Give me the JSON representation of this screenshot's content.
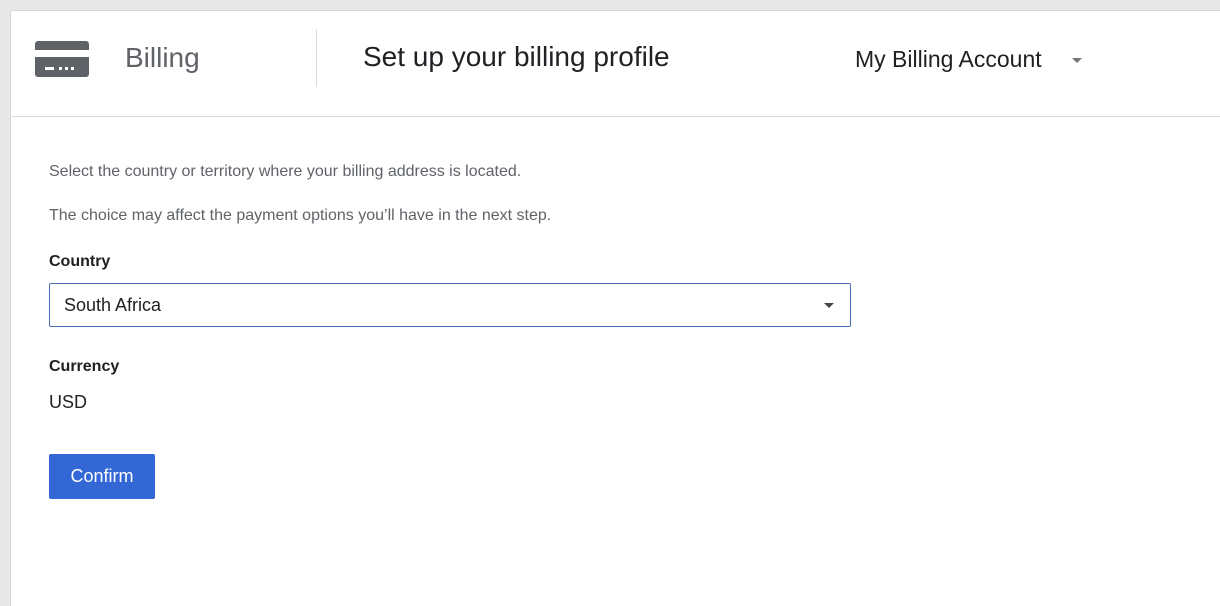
{
  "header": {
    "product_name": "Billing",
    "page_title": "Set up your billing profile",
    "account_name": "My Billing Account",
    "icons": {
      "product": "credit-card-icon",
      "account_dropdown": "caret-down-icon"
    }
  },
  "form": {
    "intro_line_1": "Select the country or territory where your billing address is located.",
    "intro_line_2": "The choice may affect the payment options you’ll have in the next step.",
    "country_label": "Country",
    "country_value": "South Africa",
    "currency_label": "Currency",
    "currency_value": "USD",
    "confirm_label": "Confirm"
  },
  "colors": {
    "accent": "#3367d6",
    "select_border": "#4a6fb5",
    "secondary_text": "#5f6368",
    "primary_text": "#202124",
    "icon": "#5f6368"
  }
}
